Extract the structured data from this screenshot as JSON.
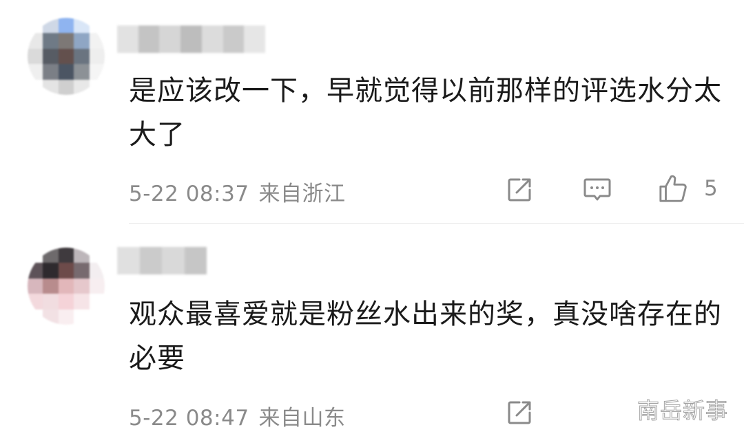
{
  "comments": [
    {
      "text": "是应该改一下，早就觉得以前那样的评选水分太大了",
      "date": "5-22 08:37",
      "location": "来自浙江",
      "likes": "5"
    },
    {
      "text": "观众最喜爱就是粉丝水出来的奖，真没啥存在的必要",
      "date": "5-22 08:47",
      "location": "来自山东"
    }
  ],
  "icons": {
    "share": "share-edit-icon",
    "reply": "comment-bubble-icon",
    "like": "thumbs-up-icon"
  },
  "watermark": "南岳新事",
  "colors": {
    "text": "#1a1a1a",
    "meta": "#8a8a8a",
    "divider": "#e6e6e6"
  }
}
